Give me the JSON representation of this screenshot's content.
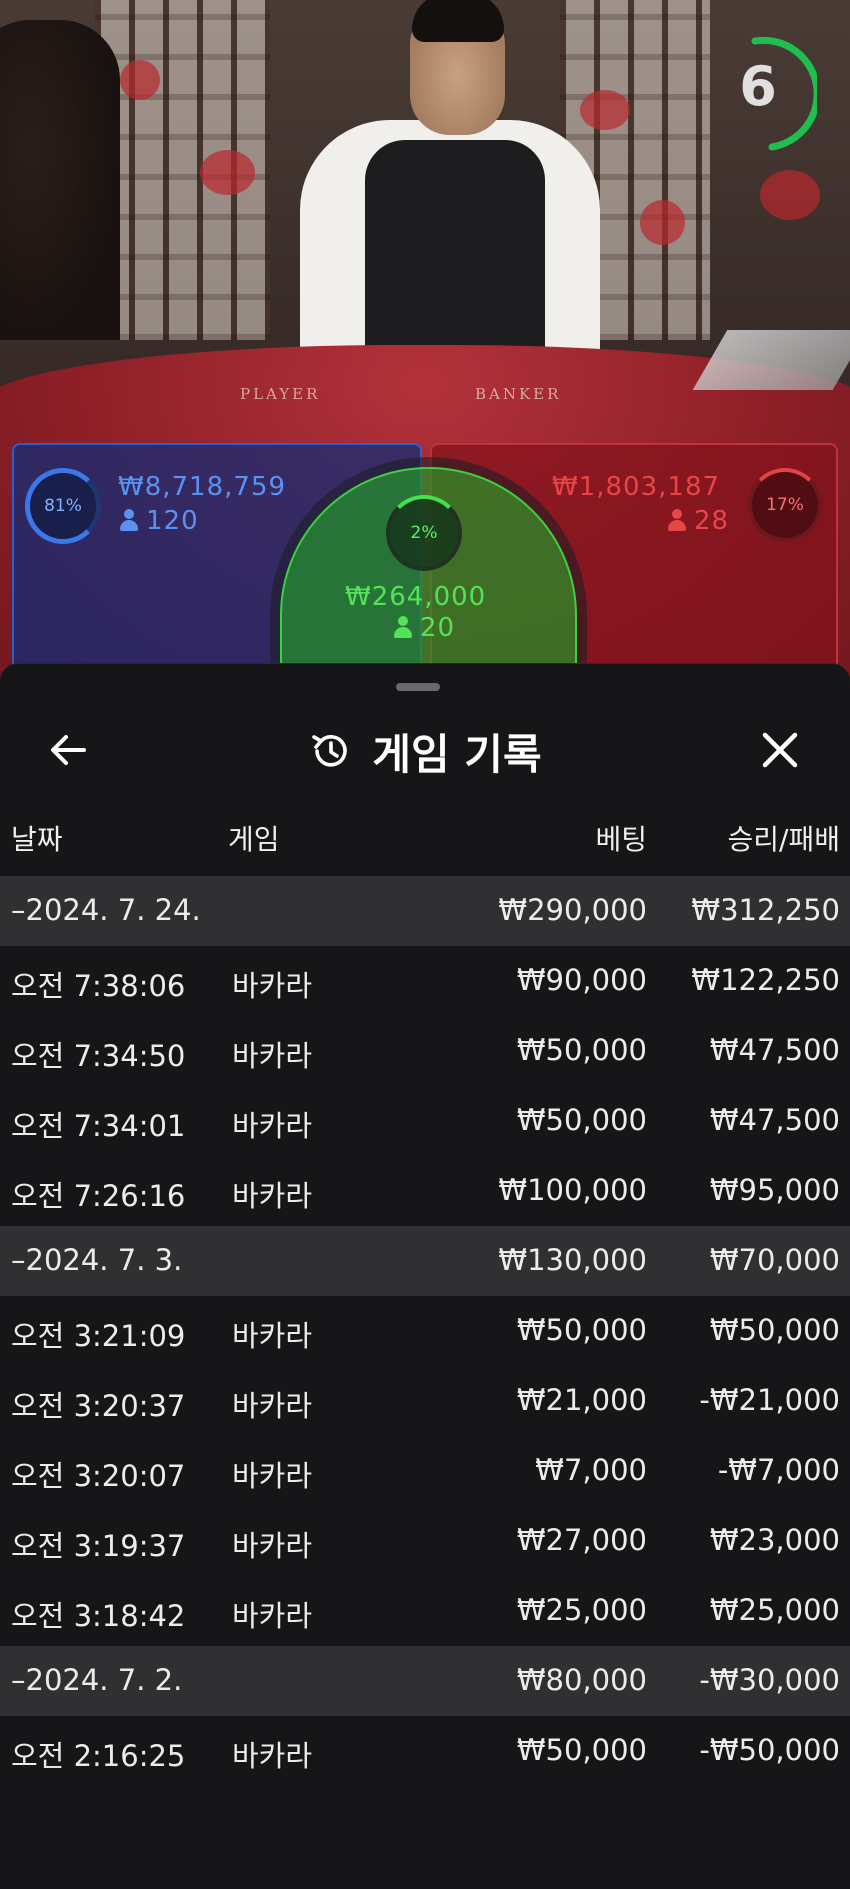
{
  "live_table": {
    "timer_value": "6",
    "table_labels": {
      "player": "PLAYER",
      "banker": "BANKER"
    },
    "player_bet": {
      "percent": "81%",
      "amount": "₩8,718,759",
      "players": "120",
      "color": "#2c5fd0"
    },
    "banker_bet": {
      "percent": "17%",
      "amount": "₩1,803,187",
      "players": "28",
      "color": "#c0333c"
    },
    "tie_bet": {
      "percent": "2%",
      "amount": "₩264,000",
      "players": "20",
      "color": "#3bd13f"
    }
  },
  "history": {
    "title": "게임 기록",
    "icons": {
      "back": "arrow-left-icon",
      "history": "history-clock-icon",
      "close": "close-icon"
    },
    "columns": {
      "date": "날짜",
      "game": "게임",
      "bet": "베팅",
      "result": "승리/패배"
    },
    "groups": [
      {
        "date": "–2024. 7. 24.",
        "bet_total": "₩290,000",
        "result_total": "₩312,250",
        "entries": [
          {
            "time": "오전 7:38:06",
            "game": "바카라",
            "bet": "₩90,000",
            "result": "₩122,250"
          },
          {
            "time": "오전 7:34:50",
            "game": "바카라",
            "bet": "₩50,000",
            "result": "₩47,500"
          },
          {
            "time": "오전 7:34:01",
            "game": "바카라",
            "bet": "₩50,000",
            "result": "₩47,500"
          },
          {
            "time": "오전 7:26:16",
            "game": "바카라",
            "bet": "₩100,000",
            "result": "₩95,000"
          }
        ]
      },
      {
        "date": "–2024. 7. 3.",
        "bet_total": "₩130,000",
        "result_total": "₩70,000",
        "entries": [
          {
            "time": "오전 3:21:09",
            "game": "바카라",
            "bet": "₩50,000",
            "result": "₩50,000"
          },
          {
            "time": "오전 3:20:37",
            "game": "바카라",
            "bet": "₩21,000",
            "result": "-₩21,000"
          },
          {
            "time": "오전 3:20:07",
            "game": "바카라",
            "bet": "₩7,000",
            "result": "-₩7,000"
          },
          {
            "time": "오전 3:19:37",
            "game": "바카라",
            "bet": "₩27,000",
            "result": "₩23,000"
          },
          {
            "time": "오전 3:18:42",
            "game": "바카라",
            "bet": "₩25,000",
            "result": "₩25,000"
          }
        ]
      },
      {
        "date": "–2024. 7. 2.",
        "bet_total": "₩80,000",
        "result_total": "-₩30,000",
        "entries": [
          {
            "time": "오전 2:16:25",
            "game": "바카라",
            "bet": "₩50,000",
            "result": "-₩50,000"
          }
        ]
      }
    ]
  }
}
